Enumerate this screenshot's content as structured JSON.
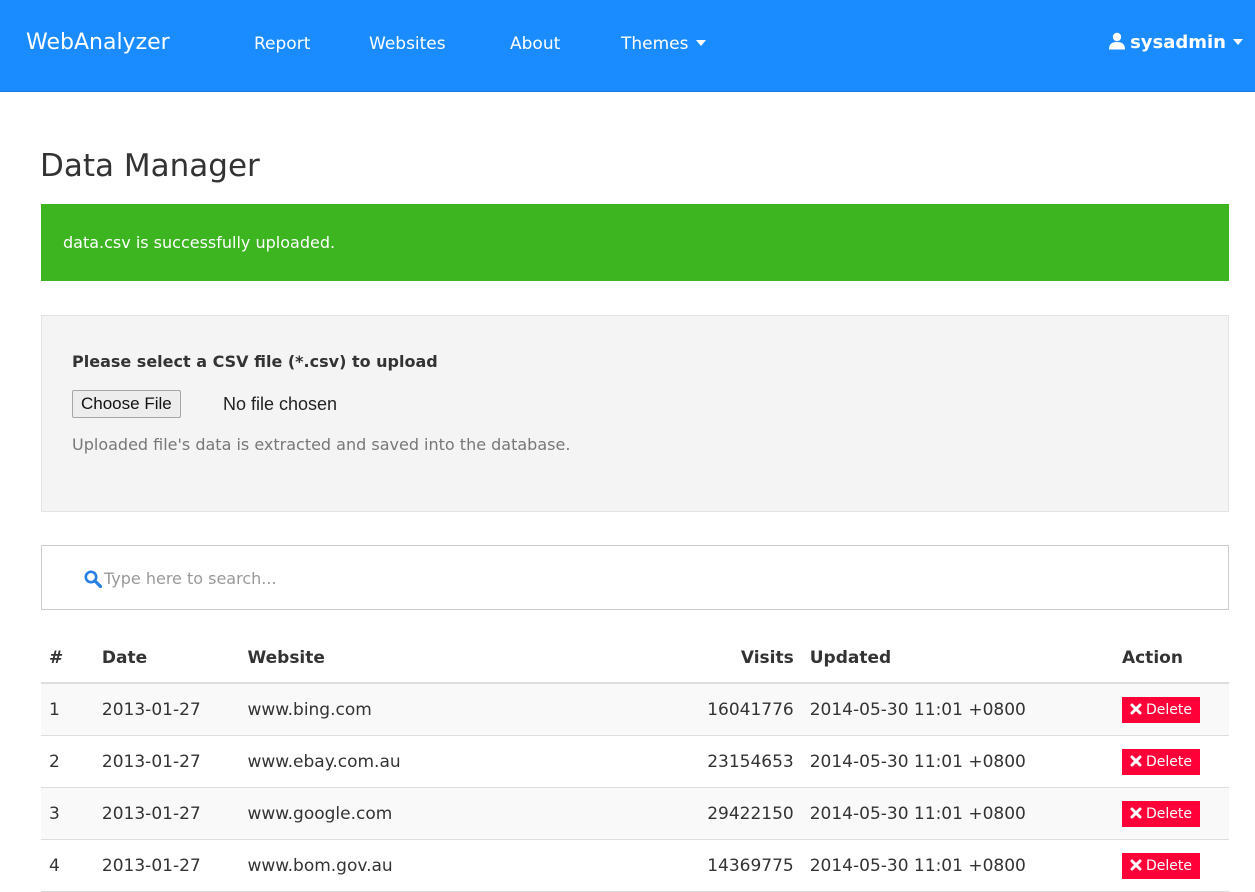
{
  "navbar": {
    "brand": "WebAnalyzer",
    "links": [
      {
        "label": "Report"
      },
      {
        "label": "Websites"
      },
      {
        "label": "About"
      },
      {
        "label": "Themes"
      }
    ],
    "user": "sysadmin",
    "bg_color": "#1a8cff"
  },
  "page": {
    "title": "Data Manager"
  },
  "alert": {
    "message": "data.csv is successfully uploaded.",
    "color": "#3cb521"
  },
  "upload": {
    "label": "Please select a CSV file (*.csv) to upload",
    "button_label": "Choose File",
    "file_status": "No file chosen",
    "help_text": "Uploaded file's data is extracted and saved into the database."
  },
  "search": {
    "placeholder": "Type here to search...",
    "icon": "search-icon"
  },
  "table": {
    "headers": {
      "num": "#",
      "date": "Date",
      "website": "Website",
      "visits": "Visits",
      "updated": "Updated",
      "action": "Action"
    },
    "delete_label": "Delete",
    "delete_color": "#ff0039",
    "rows": [
      {
        "num": "1",
        "date": "2013-01-27",
        "website": "www.bing.com",
        "visits": "16041776",
        "updated": "2014-05-30 11:01 +0800"
      },
      {
        "num": "2",
        "date": "2013-01-27",
        "website": "www.ebay.com.au",
        "visits": "23154653",
        "updated": "2014-05-30 11:01 +0800"
      },
      {
        "num": "3",
        "date": "2013-01-27",
        "website": "www.google.com",
        "visits": "29422150",
        "updated": "2014-05-30 11:01 +0800"
      },
      {
        "num": "4",
        "date": "2013-01-27",
        "website": "www.bom.gov.au",
        "visits": "14369775",
        "updated": "2014-05-30 11:01 +0800"
      }
    ]
  }
}
